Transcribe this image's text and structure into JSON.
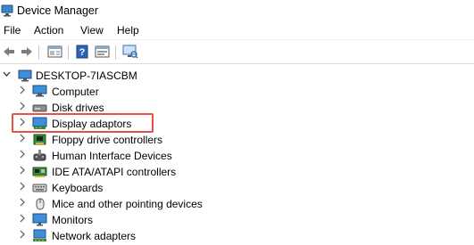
{
  "window": {
    "title": "Device Manager"
  },
  "menu": [
    "File",
    "Action",
    "View",
    "Help"
  ],
  "toolbar": {
    "buttons": [
      "back-arrow-icon",
      "forward-arrow-icon",
      "properties-icon",
      "help-icon",
      "update-driver-icon",
      "scan-hardware-icon"
    ]
  },
  "tree": {
    "root": "DESKTOP-7IASCBM",
    "items": [
      {
        "label": "Computer",
        "icon": "computer-icon"
      },
      {
        "label": "Disk drives",
        "icon": "disk-drive-icon"
      },
      {
        "label": "Display adaptors",
        "icon": "display-adapter-icon"
      },
      {
        "label": "Floppy drive controllers",
        "icon": "floppy-controller-icon"
      },
      {
        "label": "Human Interface Devices",
        "icon": "hid-icon"
      },
      {
        "label": "IDE ATA/ATAPI controllers",
        "icon": "ide-controller-icon"
      },
      {
        "label": "Keyboards",
        "icon": "keyboard-icon"
      },
      {
        "label": "Mice and other pointing devices",
        "icon": "mouse-icon"
      },
      {
        "label": "Monitors",
        "icon": "monitor-icon"
      },
      {
        "label": "Network adapters",
        "icon": "network-adapter-icon"
      }
    ],
    "highlight_color": "#e8504a"
  }
}
